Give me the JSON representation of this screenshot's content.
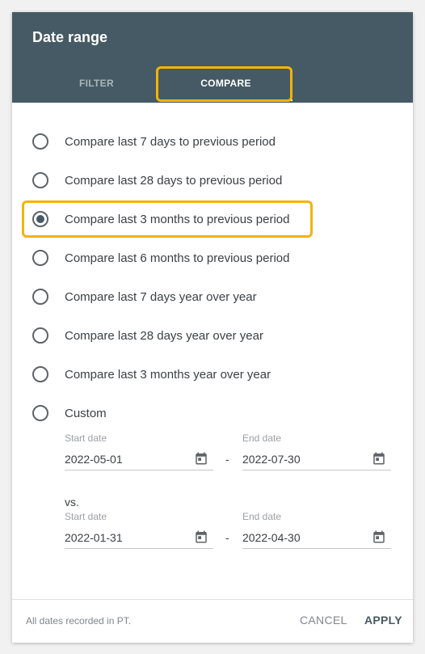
{
  "dialog": {
    "title": "Date range",
    "tabs": [
      {
        "label": "FILTER",
        "active": false
      },
      {
        "label": "COMPARE",
        "active": true
      }
    ],
    "options": [
      {
        "label": "Compare last 7 days to previous period",
        "checked": false
      },
      {
        "label": "Compare last 28 days to previous period",
        "checked": false
      },
      {
        "label": "Compare last 3 months to previous period",
        "checked": true
      },
      {
        "label": "Compare last 6 months to previous period",
        "checked": false
      },
      {
        "label": "Compare last 7 days year over year",
        "checked": false
      },
      {
        "label": "Compare last 28 days year over year",
        "checked": false
      },
      {
        "label": "Compare last 3 months year over year",
        "checked": false
      },
      {
        "label": "Custom",
        "checked": false
      }
    ],
    "custom": {
      "range1": {
        "start_label": "Start date",
        "start_value": "2022-05-01",
        "end_label": "End date",
        "end_value": "2022-07-30"
      },
      "separator": "-",
      "vs_label": "vs.",
      "range2": {
        "start_label": "Start date",
        "start_value": "2022-01-31",
        "end_label": "End date",
        "end_value": "2022-04-30"
      }
    },
    "footer": {
      "note": "All dates recorded in PT.",
      "cancel_label": "CANCEL",
      "apply_label": "APPLY"
    }
  },
  "colors": {
    "header": "#455a64",
    "highlight": "#f4b400"
  },
  "icons": {
    "calendar": "calendar-icon"
  }
}
